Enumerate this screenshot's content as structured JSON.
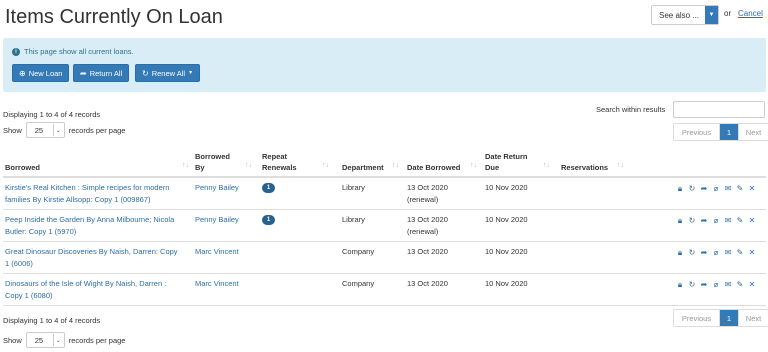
{
  "page": {
    "title": "Items Currently On Loan"
  },
  "topright": {
    "see_also": "See also ...",
    "or": "or",
    "cancel": "Cancel"
  },
  "info": {
    "message": "This page show all current loans.",
    "buttons": {
      "new_loan": "New Loan",
      "return_all": "Return All",
      "renew_all": "Renew All"
    }
  },
  "list": {
    "displaying": "Displaying 1 to 4 of 4 records",
    "show": "Show",
    "per_page_value": "25",
    "per_page_suffix": "records per page",
    "search_label": "Search within results",
    "pagination": {
      "previous": "Previous",
      "current": "1",
      "next": "Next"
    }
  },
  "table": {
    "headers": {
      "borrowed": "Borrowed",
      "borrowed_by_1": "Borrowed",
      "borrowed_by_2": "By",
      "repeat_1": "Repeat",
      "repeat_2": "Renewals",
      "department": "Department",
      "date_borrowed": "Date Borrowed",
      "due_1": "Date Return",
      "due_2": "Due",
      "reservations": "Reservations"
    },
    "rows": [
      {
        "item_1": "Kirstie's Real Kitchen : Simple recipes for modern",
        "item_2": "families By Kirstie Allsopp: Copy 1 (009867)",
        "borrower": "Penny Bailey",
        "renewals": "1",
        "department": "Library",
        "date_borrowed": "13 Oct 2020",
        "date_note": "(renewal)",
        "due": "10 Nov 2020"
      },
      {
        "item_1": "Peep Inside the Garden By Anna Milbourne; Nicola",
        "item_2": "Butler: Copy 1 (5970)",
        "borrower": "Penny Bailey",
        "renewals": "1",
        "department": "Library",
        "date_borrowed": "13 Oct 2020",
        "date_note": "(renewal)",
        "due": "10 Nov 2020"
      },
      {
        "item_1": "Great Dinosaur Discoveries By Naish, Darren: Copy",
        "item_2": "1 (6006)",
        "borrower": "Marc Vincent",
        "renewals": "",
        "department": "Company",
        "date_borrowed": "13 Oct 2020",
        "date_note": "",
        "due": "10 Nov 2020"
      },
      {
        "item_1": "Dinosaurs of the Isle of Wight By Naish, Darren :",
        "item_2": "Copy 1 (6080)",
        "borrower": "Marc Vincent",
        "renewals": "",
        "department": "Company",
        "date_borrowed": "13 Oct 2020",
        "date_note": "",
        "due": "10 Nov 2020"
      }
    ]
  },
  "icons": [
    "lock-icon",
    "renew-icon",
    "share-icon",
    "attach-icon",
    "email-icon",
    "edit-icon",
    "delete-icon"
  ],
  "colors": {
    "primary": "#337ab7",
    "info_bg": "#d9edf7",
    "link": "#2e6da4"
  }
}
